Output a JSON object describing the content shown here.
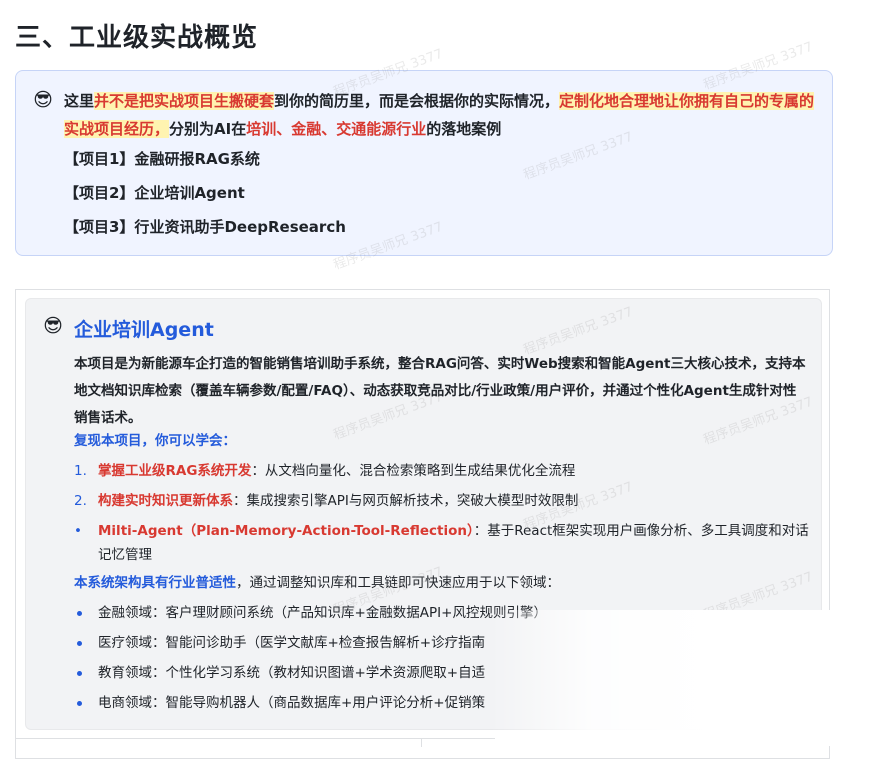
{
  "page_title": "三、工业级实战概览",
  "callout": {
    "emoji": "😎",
    "intro": {
      "p1": "这里",
      "h1": "并不是把实战项目生搬硬套",
      "p2": "到你的简历里，而是会根据你的实际情况，",
      "h2": "定制化地合理地让你拥有自己的专属的实战项目经历，",
      "p3": "分别为AI在",
      "r1": "培训、金融、交通能源行业",
      "p4": "的落地案例"
    },
    "projects": [
      "【项目1】金融研报RAG系统",
      "【项目2】企业培训Agent",
      "【项目3】行业资讯助手DeepResearch"
    ]
  },
  "agent_card": {
    "emoji": "😎",
    "title": "企业培训Agent",
    "description": "本项目是为新能源车企打造的智能销售培训助手系统，整合RAG问答、实时Web搜索和智能Agent三大核心技术，支持本地文档知识库检索（覆盖车辆参数/配置/FAQ）、动态获取竞品对比/行业政策/用户评价，并通过个性化Agent生成针对性销售话术。",
    "learn_heading": "复现本项目，你可以学会：",
    "learn_items": [
      {
        "marker": "1.",
        "title": "掌握工业级RAG系统开发",
        "text": "：从文档向量化、混合检索策略到生成结果优化全流程"
      },
      {
        "marker": "2.",
        "title": "构建实时知识更新体系",
        "text": "：集成搜索引擎API与网页解析技术，突破大模型时效限制"
      },
      {
        "marker": "•",
        "title": "Milti-Agent（Plan-Memory-Action-Tool-Reflection）",
        "text": "：基于React框架实现用户画像分析、多工具调度和对话记忆管理"
      }
    ],
    "domain_heading_bold": "本系统架构具有行业普适性",
    "domain_heading_rest": "，通过调整知识库和工具链即可快速应用于以下领域：",
    "domains": [
      "金融领域：客户理财顾问系统（产品知识库+金融数据API+风控规则引擎）",
      "医疗领域：智能问诊助手（医学文献库+检查报告解析+诊疗指南",
      "教育领域：个性化学习系统（教材知识图谱+学术资源爬取+自适",
      "电商领域：智能导购机器人（商品数据库+用户评论分析+促销策"
    ]
  },
  "watermark_text": "程序员吴师兄 3377",
  "colors": {
    "accent_blue": "#245bdb",
    "highlight_red": "#d83931",
    "highlight_yellow": "#fff3b0",
    "callout_bg": "#f0f4ff"
  }
}
